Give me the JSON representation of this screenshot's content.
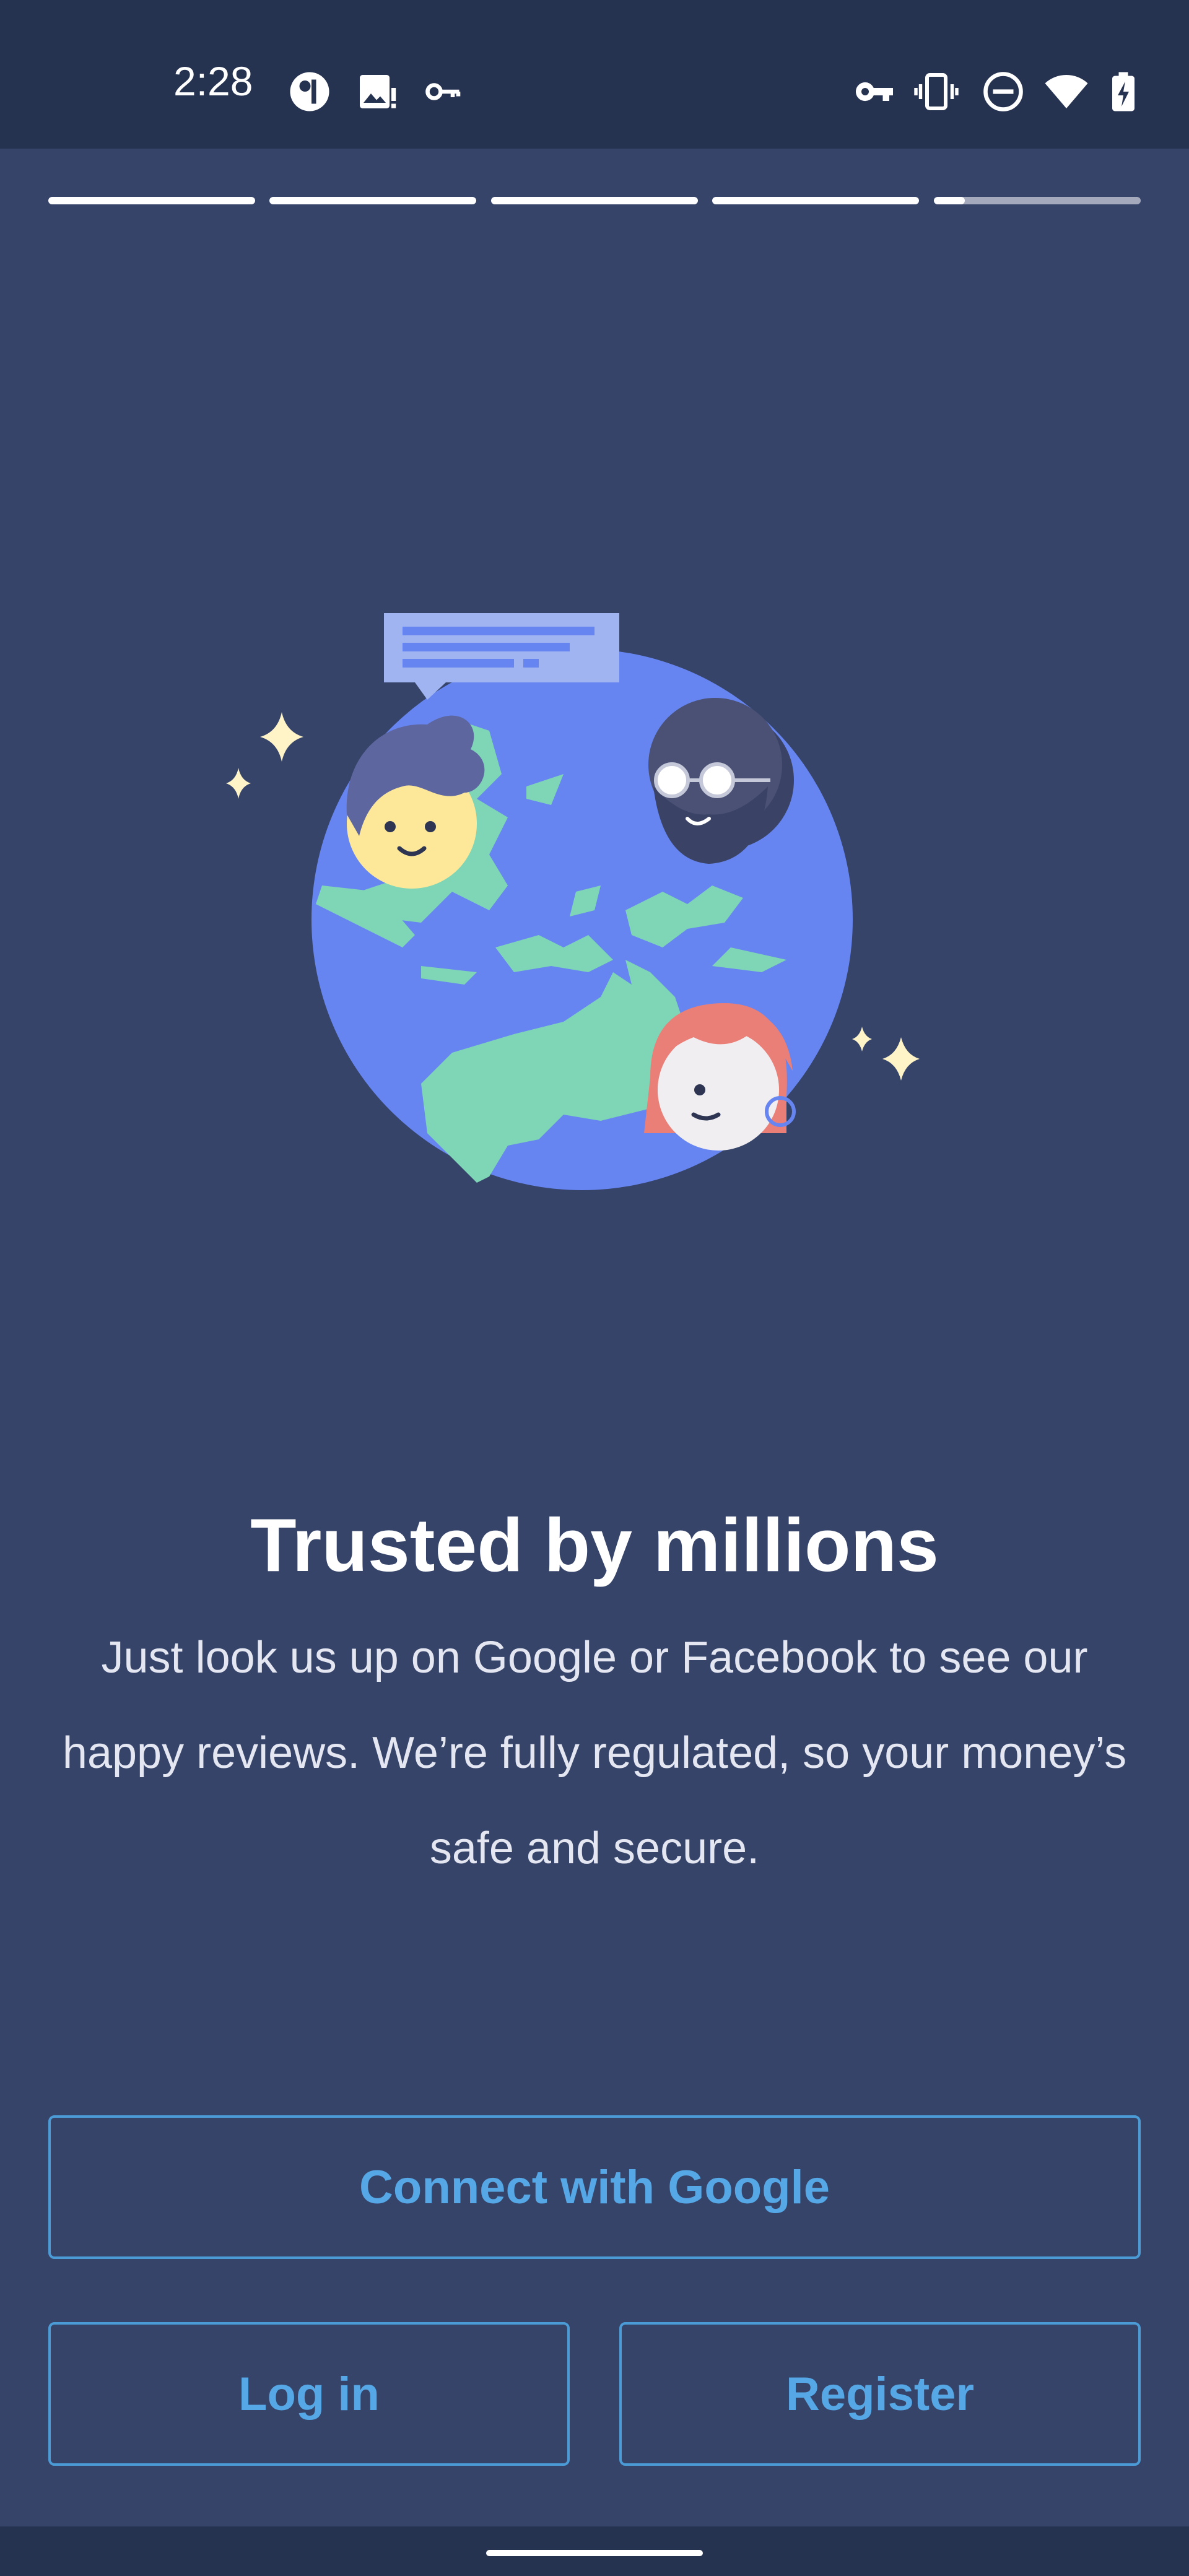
{
  "status_bar": {
    "time": "2:28",
    "left_icons": [
      "profile-icon",
      "image-alert-icon",
      "key-icon"
    ],
    "right_icons": [
      "vpn-key-icon",
      "vibrate-icon",
      "do-not-disturb-icon",
      "wifi-icon",
      "battery-charging-icon"
    ]
  },
  "progress": {
    "total_steps": 5,
    "current_step": 5,
    "current_step_fill": 0.15
  },
  "illustration": {
    "icon": "globe-people-illustration"
  },
  "content": {
    "title": "Trusted by millions",
    "body": "Just look us up on Google or Facebook to see our happy reviews. We’re fully regulated, so your money’s safe and secure."
  },
  "actions": {
    "google_label": "Connect with Google",
    "login_label": "Log in",
    "register_label": "Register"
  },
  "colors": {
    "background": "#36446a",
    "status_bar": "#263350",
    "accent": "#55a7e6",
    "globe": "#6685f0",
    "land": "#7fd6b6"
  }
}
